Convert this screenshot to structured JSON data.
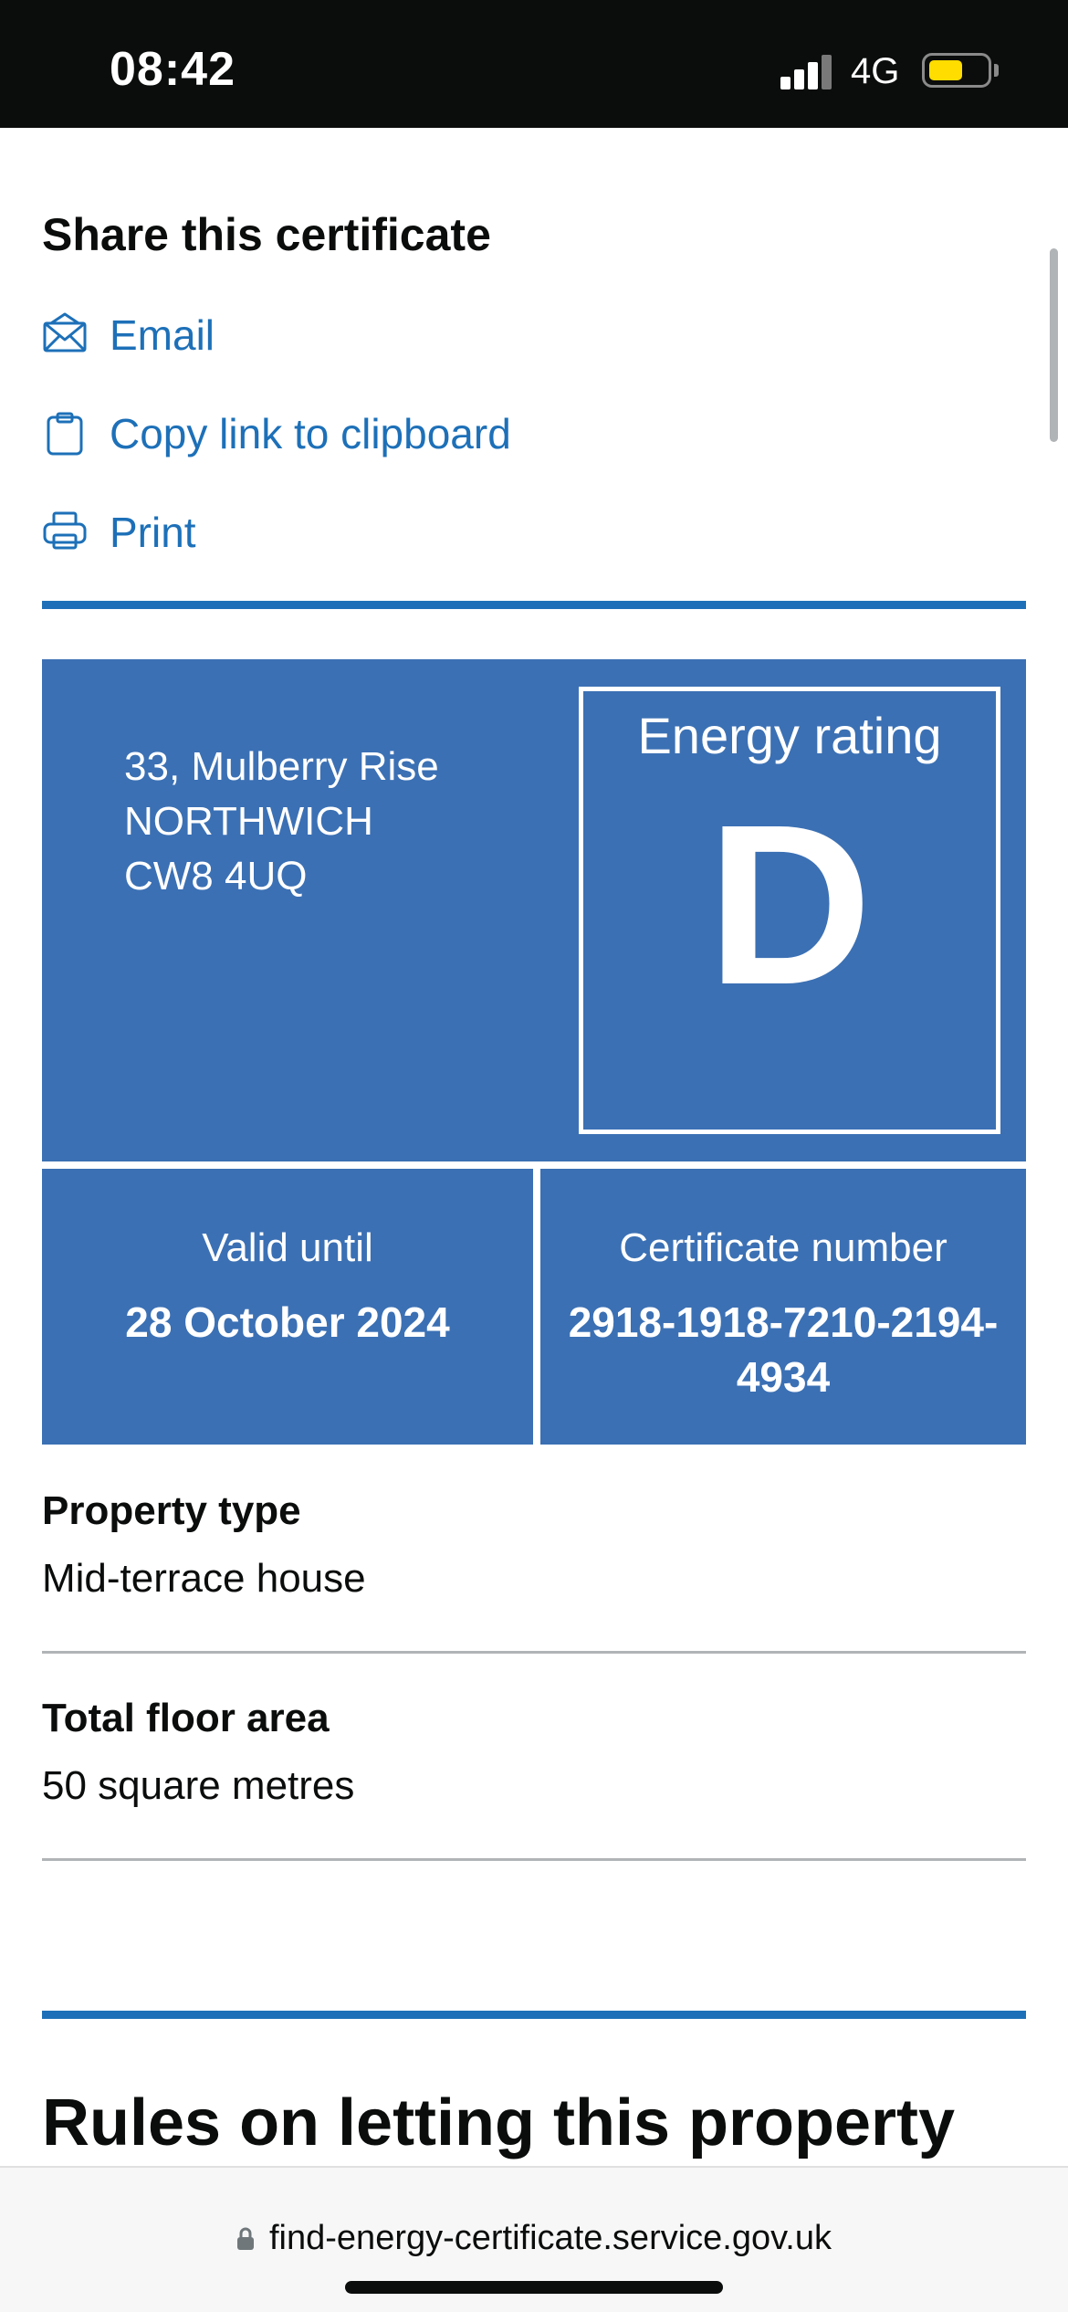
{
  "status_bar": {
    "time": "08:42",
    "network": "4G",
    "signal_icon": "signal-bars-icon",
    "battery_icon": "battery-icon",
    "battery_color": "#ffdd00"
  },
  "share": {
    "title": "Share this certificate",
    "links": [
      {
        "label": "Email",
        "icon": "envelope-icon"
      },
      {
        "label": "Copy link to clipboard",
        "icon": "clipboard-icon"
      },
      {
        "label": "Print",
        "icon": "printer-icon"
      }
    ]
  },
  "certificate": {
    "address_lines": [
      "33, Mulberry Rise",
      "NORTHWICH",
      "CW8 4UQ"
    ],
    "rating_label": "Energy rating",
    "rating": "D",
    "valid_until_label": "Valid until",
    "valid_until": "28 October 2024",
    "certificate_number_label": "Certificate number",
    "certificate_number": "2918-1918-7210-2194-4934",
    "panel_color": "#3b70b4"
  },
  "summary": {
    "property_type_label": "Property type",
    "property_type": "Mid-terrace house",
    "floor_area_label": "Total floor area",
    "floor_area": "50 square metres"
  },
  "next_section": {
    "heading": "Rules on letting this property"
  },
  "browser": {
    "url": "find-energy-certificate.service.gov.uk",
    "lock_icon": "lock-icon"
  },
  "colors": {
    "link": "#1d70b8",
    "rule": "#1d70b8",
    "divider": "#b1b4b6",
    "text": "#0b0c0c"
  }
}
